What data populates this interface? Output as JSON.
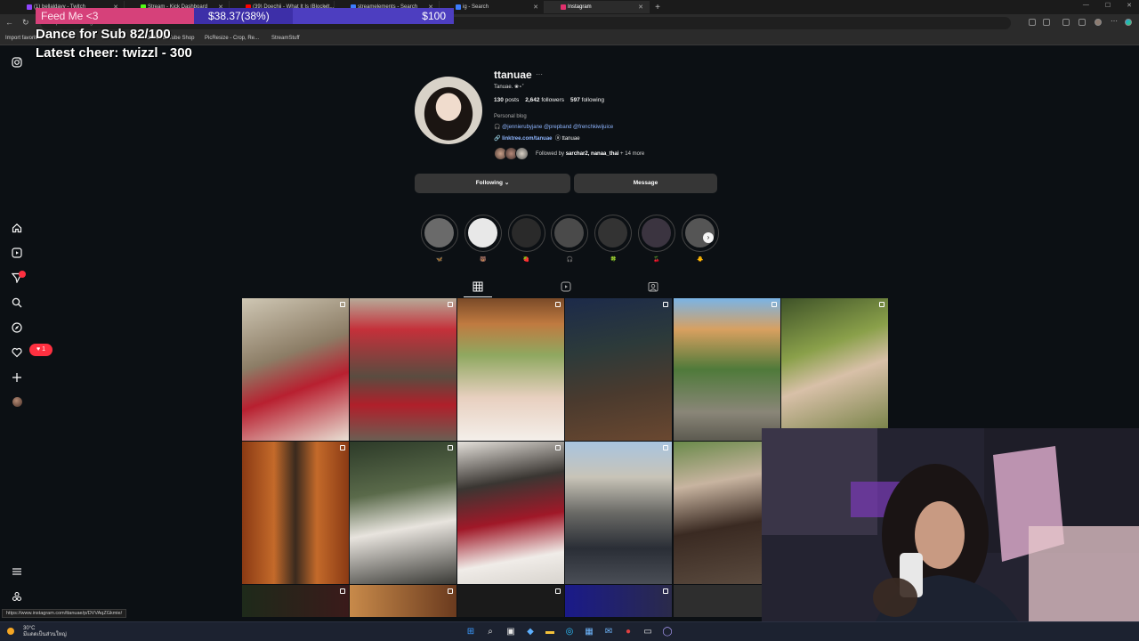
{
  "browser": {
    "tabs": [
      {
        "title": "(1) bellaldavy - Twitch",
        "fav": "#9146ff"
      },
      {
        "title": "Stream - Kick Dashboard",
        "fav": "#53fc18"
      },
      {
        "title": "(39) Doechii - What It Is (Block It...",
        "fav": "#ff0000"
      },
      {
        "title": "streamelements - Search",
        "fav": "#3c7dff"
      },
      {
        "title": "ig - Search",
        "fav": "#3c7dff"
      },
      {
        "title": "Instagram",
        "fav": "#e1306c"
      }
    ],
    "new_tab": "+",
    "url": "https://www.instagram.com/ttanuae/",
    "bookmarks": [
      "Import favorites",
      "Mobile YouTube Shop",
      "PicResize - Crop, Re...",
      "StreamStuff"
    ]
  },
  "overlay": {
    "feed_label": "Feed Me <3",
    "goal_amount": "$38.37(38%)",
    "goal_percent": 38,
    "goal_target": "$100",
    "dance": "Dance for Sub 82/100",
    "latest_cheer": "Latest cheer: twizzl - 300"
  },
  "sidebar": {
    "notification_badge": "",
    "heart_count": "1"
  },
  "profile": {
    "username": "ttanuae",
    "more": "···",
    "full_name": "Tanuae. ❀⋆˚",
    "posts_count": "130",
    "posts_label": "posts",
    "followers_count": "2,642",
    "followers_label": "followers",
    "following_count": "597",
    "following_label": "following",
    "category": "Personal blog",
    "bio_icon": "🎧",
    "bio_mentions": "@jennierubyjane @prepband @frenchkiwijuice",
    "link": "linktree.com/tanuae",
    "threads": "ⓐ ttanuae",
    "followed_by_prefix": "Followed by ",
    "followed_by_names": "sarchar2, nanaa_thai",
    "followed_by_suffix": " + 14 more",
    "following_button": "Following ⌄",
    "message_button": "Message"
  },
  "highlights": [
    {
      "label": "🦋",
      "color": "#6a6a6a"
    },
    {
      "label": "🐻",
      "color": "#e8e8e8"
    },
    {
      "label": "🍓",
      "color": "#2a2a2a"
    },
    {
      "label": "🎧",
      "color": "#4a4a4a"
    },
    {
      "label": "🍀",
      "color": "#333333"
    },
    {
      "label": "🍒",
      "color": "#3b3440"
    },
    {
      "label": "🐥",
      "color": "#555555"
    }
  ],
  "highlight_next": "›",
  "status_url": "https://www.instagram.com/ttanuae/p/DVVAqZGkmie/",
  "taskbar": {
    "temp": "30°C",
    "weather": "มีแดดเป็นส่วนใหญ่"
  }
}
